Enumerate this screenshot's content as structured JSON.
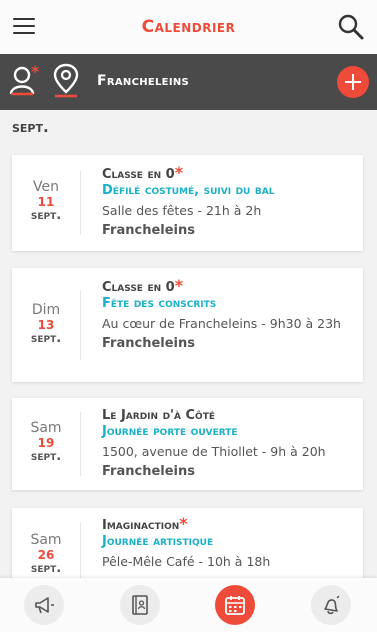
{
  "header": {
    "title": "Calendrier",
    "menu_icon": "hamburger-menu-icon",
    "search_icon": "search-icon"
  },
  "location_bar": {
    "city": "Francheleins",
    "user_star": "*",
    "user_icon": "user-icon",
    "pin_icon": "location-pin-icon",
    "add_icon": "plus-icon"
  },
  "month_label": "sept.",
  "events": [
    {
      "dow": "Ven",
      "day": "11",
      "month": "sept.",
      "organizer": "Classe en 0",
      "star": "*",
      "title": "Défilé costumé, suivi du bal",
      "place": "Salle des fêtes - 21h à 2h",
      "town": "Francheleins"
    },
    {
      "dow": "Dim",
      "day": "13",
      "month": "sept.",
      "organizer": "Classe en 0",
      "star": "*",
      "title": "Fête des conscrits",
      "place": "Au cœur de Francheleins - 9h30 à 23h",
      "town": "Francheleins"
    },
    {
      "dow": "Sam",
      "day": "19",
      "month": "sept.",
      "organizer": "Le Jardin d'à Côté",
      "star": "",
      "title": "Journée porte ouverte",
      "place": "1500, avenue de Thiollet - 9h à 20h",
      "town": "Francheleins"
    },
    {
      "dow": "Sam",
      "day": "26",
      "month": "sept.",
      "organizer": "Imaginaction",
      "star": "*",
      "title": "Journée artistique",
      "place": "Pêle-Mêle Café - 10h à 18h",
      "town": ""
    }
  ],
  "bottom_tabs": [
    {
      "icon": "megaphone-icon",
      "active": false
    },
    {
      "icon": "directory-book-icon",
      "active": false
    },
    {
      "icon": "calendar-icon",
      "active": true
    },
    {
      "icon": "alert-bell-icon",
      "active": false
    }
  ],
  "colors": {
    "accent": "#ef4b3a",
    "event_title": "#1ab0c8",
    "bar": "#4a4a4a"
  }
}
